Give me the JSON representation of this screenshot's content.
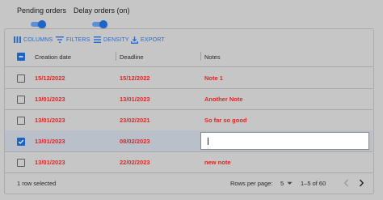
{
  "toggles": [
    {
      "label": "Pending orders",
      "on": true
    },
    {
      "label": "Delay orders (on)",
      "on": true
    }
  ],
  "toolbar": {
    "columns": "COLUMNS",
    "filters": "FILTERS",
    "density": "DENSITY",
    "export": "EXPORT"
  },
  "columns": [
    "Creation date",
    "Deadline",
    "Notes"
  ],
  "rows": [
    {
      "creation": "15/12/2022",
      "deadline": "15/12/2022",
      "note": "Note 1",
      "checked": false
    },
    {
      "creation": "13/01/2023",
      "deadline": "13/01/2023",
      "note": "Another Note",
      "checked": false
    },
    {
      "creation": "13/01/2023",
      "deadline": "23/02/2021",
      "note": "So far so good",
      "checked": false
    },
    {
      "creation": "13/01/2023",
      "deadline": "08/02/2023",
      "note": "",
      "checked": true,
      "editing": true
    },
    {
      "creation": "13/01/2023",
      "deadline": "22/02/2023",
      "note": "new note",
      "checked": false
    }
  ],
  "footer": {
    "selection": "1 row selected",
    "rows_per_page_label": "Rows per page:",
    "rows_per_page_value": "5",
    "range": "1–5 of 60"
  },
  "colors": {
    "accent": "#1e63c6",
    "cell_text": "#e42424",
    "background": "#c6c6c6"
  }
}
